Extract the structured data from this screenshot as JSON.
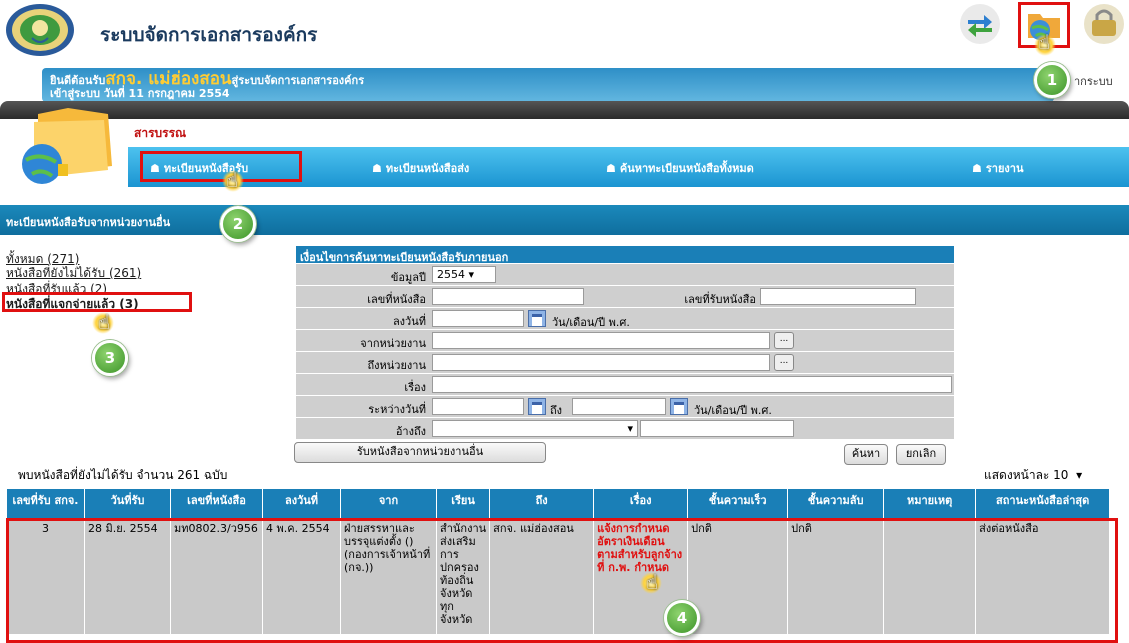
{
  "header": {
    "app_title": "ระบบจัดการเอกสารองค์กร",
    "icons": [
      "transfer-icon",
      "folder-globe-icon",
      "logout-icon"
    ]
  },
  "welcome": {
    "prefix": "ยินดีต้อนรับ",
    "org": "สกจ. แม่ฮ่องสอน",
    "suffix": "สู่ระบบจัดการเอกสารองค์กร",
    "login_line": "เข้าสู่ระบบ วันที่ 11 กรกฎาคม 2554",
    "right_text": "ากระบบ"
  },
  "module": {
    "name": "สารบรรณ"
  },
  "nav": [
    {
      "label": "ทะเบียนหนังสือรับ"
    },
    {
      "label": "ทะเบียนหนังสือส่ง"
    },
    {
      "label": "ค้นหาทะเบียนหนังสือทั้งหมด"
    },
    {
      "label": "รายงาน"
    }
  ],
  "section_title": "ทะเบียนหนังสือรับจากหน่วยงานอื่น",
  "left_links": [
    {
      "label": "ทั้งหมด (271)"
    },
    {
      "label": "หนังสือที่ยังไม่ได้รับ (261)"
    },
    {
      "label": "หนังสือที่รับแล้ว (2)"
    },
    {
      "label": "หนังสือที่แจกจ่ายแล้ว (3)"
    }
  ],
  "form": {
    "title": "เงื่อนไขการค้นหาทะเบียนหนังสือรับภายนอก",
    "year_label": "ข้อมูลปี",
    "year_value": "2554",
    "doc_no_label": "เลขที่หนังสือ",
    "recv_no_label": "เลขที่รับหนังสือ",
    "date_label": "ลงวันที่",
    "date_unit": "วัน/เดือน/ปี พ.ศ.",
    "from_label": "จากหน่วยงาน",
    "to_label": "ถึงหน่วยงาน",
    "subject_label": "เรื่อง",
    "between_label": "ระหว่างวันที่",
    "between_to": "ถึง",
    "between_unit": "วัน/เดือน/ปี พ.ศ.",
    "ref_label": "อ้างถึง",
    "dots": "...",
    "receive_button": "รับหนังสือจากหน่วยงานอื่น",
    "search_button": "ค้นหา",
    "cancel_button": "ยกเลิก"
  },
  "results": {
    "found_text": "พบหนังสือที่ยังไม่ได้รับ จำนวน 261 ฉบับ",
    "per_page": "แสดงหน้าละ 10",
    "columns": [
      "เลขที่รับ สกจ.",
      "วันที่รับ",
      "เลขที่หนังสือ",
      "ลงวันที่",
      "จาก",
      "เรียน",
      "ถึง",
      "เรื่อง",
      "ชั้นความเร็ว",
      "ชั้นความลับ",
      "หมายเหตุ",
      "สถานะหนังสือล่าสุด"
    ],
    "rows": [
      {
        "recv_no": "3",
        "recv_date": "28 มิ.ย. 2554",
        "doc_no": "มท0802.3/ว956",
        "doc_date": "4 พ.ค. 2554",
        "from": "ฝ่ายสรรหาและบรรจุแต่งตั้ง () (กองการเจ้าหน้าที่ (กจ.))",
        "attn": "สำนักงานส่งเสริมการปกครองท้องถิ่นจังหวัดทุกจังหวัด",
        "to": "สกจ. แม่ฮ่องสอน",
        "subject": "แจ้งการกำหนดอัตราเงินเดือนตามสำหรับลูกจ้างที่ ก.พ. กำหนด",
        "speed": "ปกติ",
        "secrecy": "ปกติ",
        "note": "",
        "status": "ส่งต่อหนังสือ"
      }
    ]
  },
  "steps": [
    "1",
    "2",
    "3",
    "4"
  ],
  "colors": {
    "highlight": "#e01010",
    "nav_blue": "#1b94d1",
    "badge_green": "#3c9428"
  }
}
